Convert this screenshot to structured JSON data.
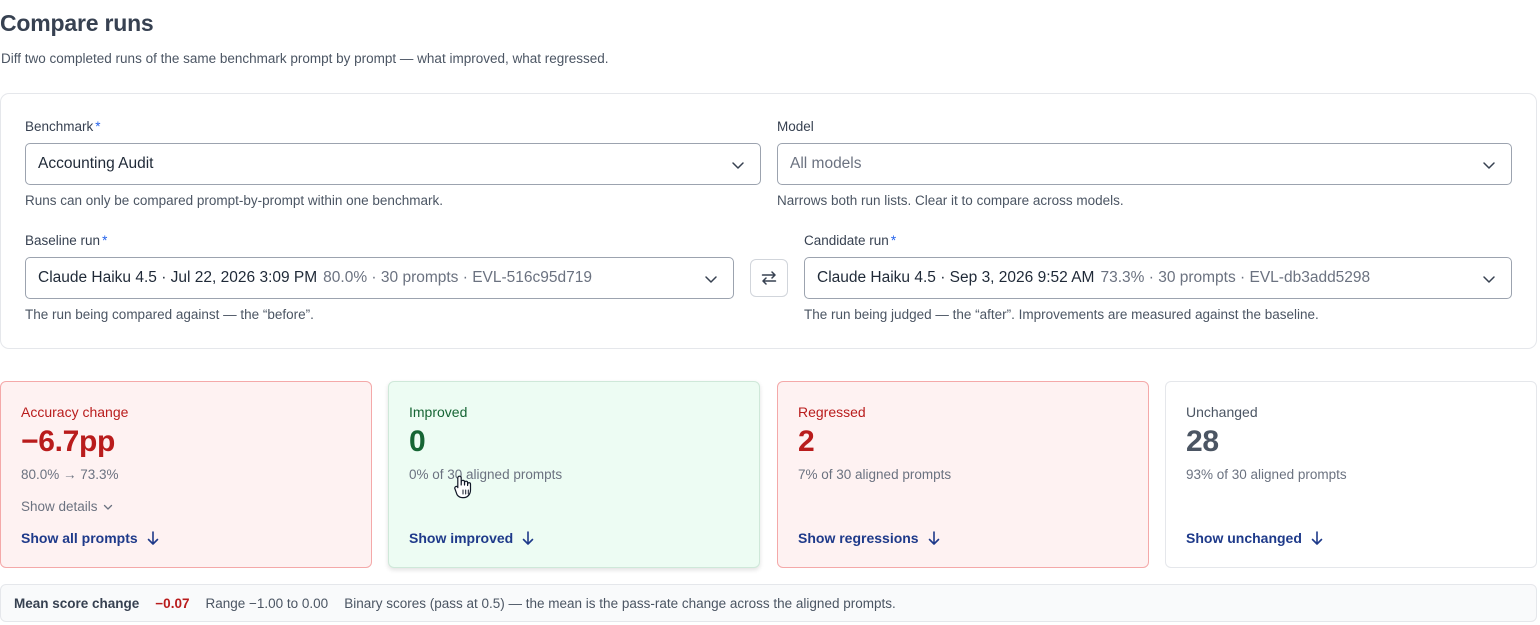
{
  "page": {
    "title": "Compare runs",
    "subtitle": "Diff two completed runs of the same benchmark prompt by prompt — what improved, what regressed."
  },
  "form": {
    "benchmark": {
      "label": "Benchmark",
      "required_mark": "*",
      "value": "Accounting Audit",
      "help": "Runs can only be compared prompt-by-prompt within one benchmark."
    },
    "model": {
      "label": "Model",
      "placeholder": "All models",
      "help": "Narrows both run lists. Clear it to compare across models."
    },
    "baseline": {
      "label": "Baseline run",
      "required_mark": "*",
      "value_main": "Claude Haiku 4.5 · Jul 22, 2026 3:09 PM",
      "value_meta": "80.0% · 30 prompts · EVL-516c95d719",
      "help": "The run being compared against — the “before”."
    },
    "candidate": {
      "label": "Candidate run",
      "required_mark": "*",
      "value_main": "Claude Haiku 4.5 · Sep 3, 2026 9:52 AM",
      "value_meta": "73.3% · 30 prompts · EVL-db3add5298",
      "help": "The run being judged — the “after”. Improvements are measured against the baseline."
    },
    "swap_icon": "swap-arrows-icon"
  },
  "stats": {
    "accuracy": {
      "label": "Accuracy change",
      "value": "−6.7pp",
      "sub": "80.0% → 73.3%",
      "details": "Show details",
      "link": "Show all prompts"
    },
    "improved": {
      "label": "Improved",
      "value": "0",
      "sub": "0% of 30 aligned prompts",
      "link": "Show improved"
    },
    "regressed": {
      "label": "Regressed",
      "value": "2",
      "sub": "7% of 30 aligned prompts",
      "link": "Show regressions"
    },
    "unchanged": {
      "label": "Unchanged",
      "value": "28",
      "sub": "93% of 30 aligned prompts",
      "link": "Show unchanged"
    }
  },
  "mean_score": {
    "label": "Mean score change",
    "value": "−0.07",
    "range": "Range −1.00 to 0.00",
    "note": "Binary scores (pass at 0.5) — the mean is the pass-rate change across the aligned prompts."
  },
  "colors": {
    "required": "#2563eb",
    "negative": "#b91c1c",
    "positive": "#166534",
    "link": "#1e3a8a"
  }
}
